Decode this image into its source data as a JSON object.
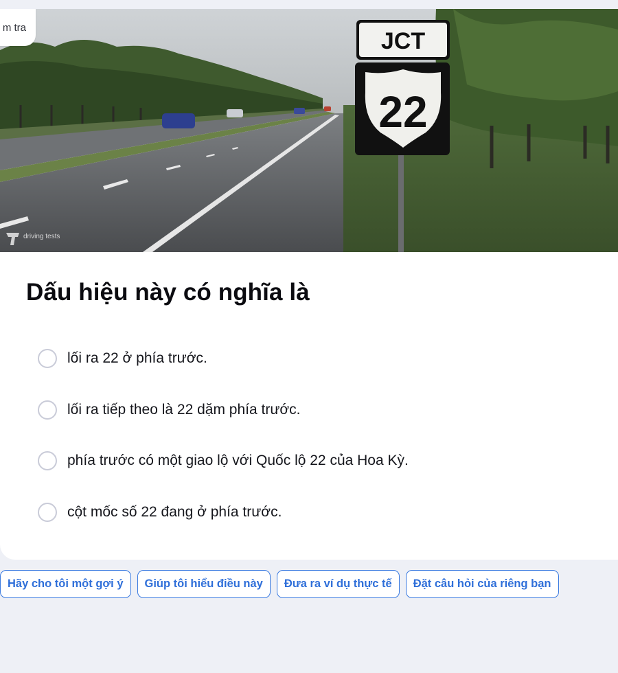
{
  "check_tab": {
    "label": "m tra"
  },
  "image": {
    "sign_top_text": "JCT",
    "sign_number": "22",
    "watermark": "driving tests"
  },
  "question": {
    "text": "Dấu hiệu này có nghĩa là"
  },
  "options": [
    {
      "label": "lối ra 22 ở phía trước."
    },
    {
      "label": "lối ra tiếp theo là 22 dặm phía trước."
    },
    {
      "label": "phía trước có một giao lộ với Quốc lộ 22 của Hoa Kỳ."
    },
    {
      "label": "cột mốc số 22 đang ở phía trước."
    }
  ],
  "chips": [
    {
      "label": "Hãy cho tôi một gợi ý"
    },
    {
      "label": "Giúp tôi hiểu điều này"
    },
    {
      "label": "Đưa ra ví dụ thực tế"
    },
    {
      "label": "Đặt câu hỏi của riêng bạn"
    }
  ],
  "colors": {
    "page_background": "#eef0f6",
    "card_background": "#ffffff",
    "accent_blue": "#2f6fd9",
    "radio_border": "#c9cbd8"
  }
}
